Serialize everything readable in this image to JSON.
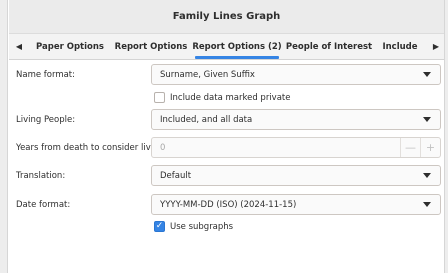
{
  "window": {
    "title": "Family Lines Graph"
  },
  "tabs": [
    {
      "label": "Paper Options"
    },
    {
      "label": "Report Options"
    },
    {
      "label": "Report Options (2)"
    },
    {
      "label": "People of Interest"
    },
    {
      "label": "Include"
    }
  ],
  "active_tab_index": 2,
  "form": {
    "name_format": {
      "label": "Name format:",
      "value": "Surname, Given Suffix"
    },
    "include_private": {
      "label": "Include data marked private",
      "checked": false
    },
    "living_people": {
      "label": "Living People:",
      "value": "Included, and all data"
    },
    "years_from_death": {
      "label": "Years from death to consider living:",
      "value": "0",
      "minus": "—",
      "plus": "+"
    },
    "translation": {
      "label": "Translation:",
      "value": "Default"
    },
    "date_format": {
      "label": "Date format:",
      "value": "YYYY-MM-DD (ISO) (2024-11-15)"
    },
    "use_subgraphs": {
      "label": "Use subgraphs",
      "checked": true
    }
  },
  "colors": {
    "accent": "#3584e4",
    "text": "#2e2e2e",
    "disabled": "#a8a8a8"
  }
}
